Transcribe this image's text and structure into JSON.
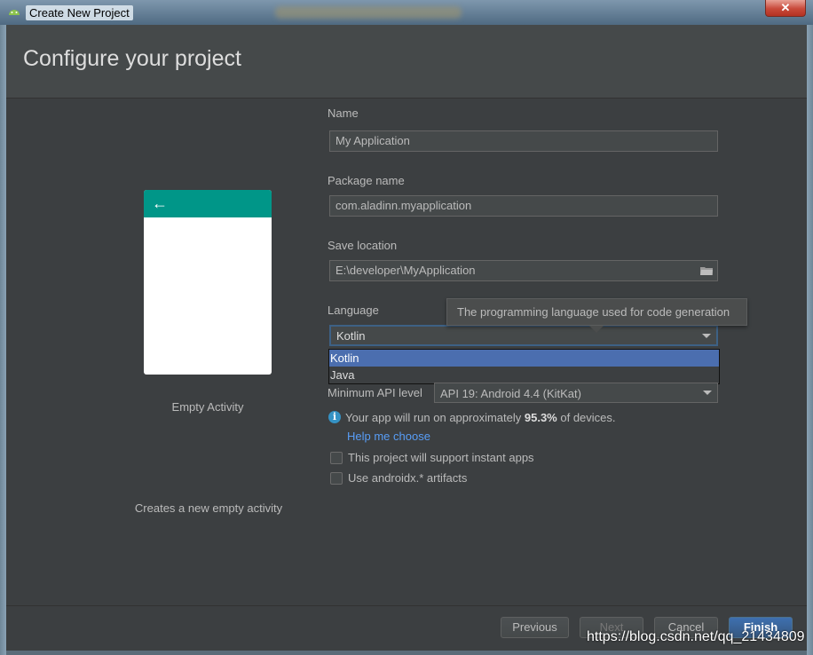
{
  "window": {
    "title": "Create New Project",
    "close_label": "✕"
  },
  "header": {
    "title": "Configure your project"
  },
  "preview": {
    "back_label": "←",
    "activity_name": "Empty Activity",
    "activity_desc": "Creates a new empty activity"
  },
  "form": {
    "name_label": "Name",
    "name_value": "My Application",
    "package_label": "Package name",
    "package_value": "com.aladinn.myapplication",
    "location_label": "Save location",
    "location_value": "E:\\developer\\MyApplication",
    "language_label": "Language",
    "language_value": "Kotlin",
    "language_options": [
      "Kotlin",
      "Java"
    ],
    "language_tooltip": "The programming language used for code generation",
    "api_label": "Minimum API level",
    "api_value": "API 19: Android 4.4 (KitKat)",
    "info_prefix": "Your app will run on approximately",
    "info_percent": "95.3%",
    "info_suffix": "of devices.",
    "help_link": "Help me choose",
    "instant_apps_label": "This project will support instant apps",
    "androidx_label": "Use androidx.* artifacts"
  },
  "buttons": {
    "previous": "Previous",
    "next": "Next",
    "cancel": "Cancel",
    "finish": "Finish"
  },
  "watermark": "https://blog.csdn.net/qq_21434809",
  "colors": {
    "accent": "#009688",
    "selection": "#4b6eaf",
    "link": "#589df6",
    "background": "#3c3f41"
  }
}
